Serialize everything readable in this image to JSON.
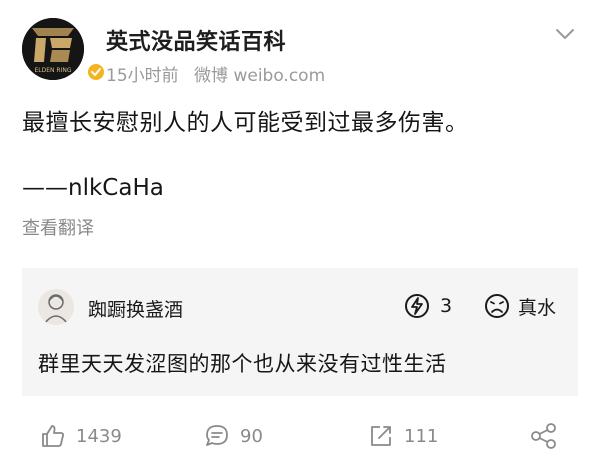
{
  "post": {
    "author": "英式没品笑话百科",
    "avatar_text": "ELDEN RING",
    "time": "15小时前",
    "source": "微博 weibo.com",
    "text": "最擅长安慰别人的人可能受到过最多伤害。",
    "signature": "——nlkCaHa",
    "translate_label": "查看翻译"
  },
  "comment": {
    "user": "踟蹰换盏酒",
    "reaction_count": "3",
    "reaction_label": "真水",
    "text": "群里天天发涩图的那个也从来没有过性生活"
  },
  "actions": {
    "likes": "1439",
    "comments": "90",
    "reposts": "111"
  },
  "icons": {
    "verified": "verified-badge-icon",
    "menu": "chevron-down-icon",
    "bolt": "bolt-reaction-icon",
    "sad": "sad-face-icon",
    "like": "thumbs-up-icon",
    "comment": "comment-bubble-icon",
    "repost": "repost-icon",
    "share": "share-icon"
  },
  "colors": {
    "verified": "#f3b51f",
    "meta_text": "#9a9a9a",
    "card_bg": "#f5f5f5"
  }
}
